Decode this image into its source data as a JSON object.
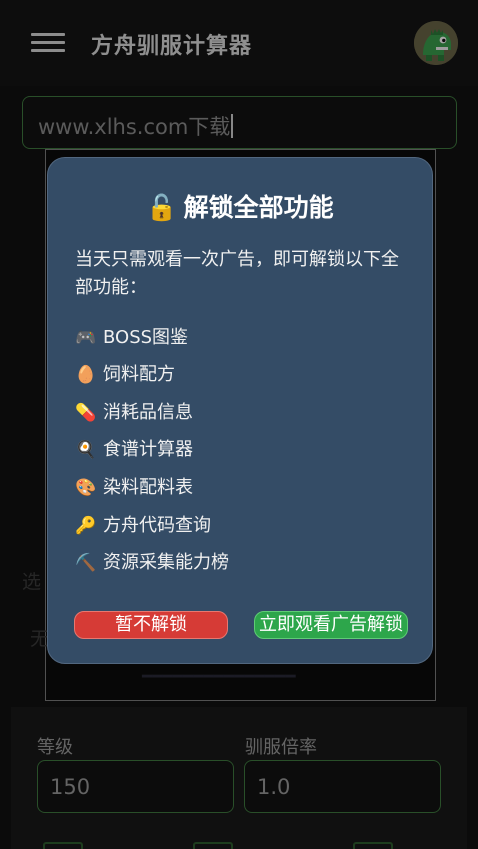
{
  "appbar": {
    "title": "方舟驯服计算器"
  },
  "search": {
    "value": "www.xlhs.com下载"
  },
  "background": {
    "select_label_partial": "选",
    "none_partial": "无"
  },
  "form": {
    "level_label": "等级",
    "level_value": "150",
    "rate_label": "驯服倍率",
    "rate_value": "1.0"
  },
  "dialog": {
    "title_icon": "🔓",
    "title": "解锁全部功能",
    "description": "当天只需观看一次广告，即可解锁以下全部功能：",
    "features": [
      {
        "icon": "🎮",
        "label": "BOSS图鉴"
      },
      {
        "icon": "🥚",
        "label": "饲料配方"
      },
      {
        "icon": "💊",
        "label": "消耗品信息"
      },
      {
        "icon": "🍳",
        "label": "食谱计算器"
      },
      {
        "icon": "🎨",
        "label": "染料配料表"
      },
      {
        "icon": "🔑",
        "label": "方舟代码查询"
      },
      {
        "icon": "⛏️",
        "label": "资源采集能力榜"
      }
    ],
    "cancel_label": "暂不解锁",
    "watch_label": "立即观看广告解锁"
  },
  "colors": {
    "dialog_bg": "#344c66",
    "cancel_button": "#d63b36",
    "watch_button": "#2da64b",
    "field_border": "#3f7a3f"
  }
}
